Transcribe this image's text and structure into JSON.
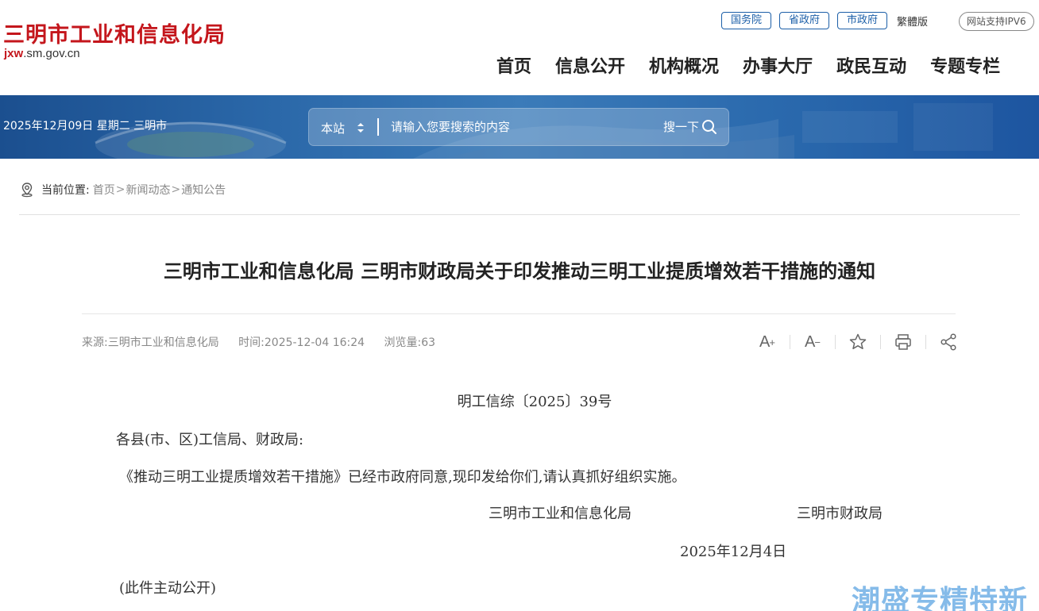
{
  "header": {
    "site_title": "三明市工业和信息化局",
    "domain_prefix": "jxw",
    "domain_suffix": ".sm.gov.cn",
    "top_links": [
      "国务院",
      "省政府",
      "市政府"
    ],
    "traditional_label": "繁體版",
    "ipv6_label": "网站支持IPV6",
    "nav": [
      "首页",
      "信息公开",
      "机构概况",
      "办事大厅",
      "政民互动",
      "专题专栏"
    ]
  },
  "banner": {
    "date_text": "2025年12月09日 星期二 三明市",
    "search_scope": "本站",
    "search_placeholder": "请输入您要搜索的内容",
    "search_button": "搜一下"
  },
  "breadcrumb": {
    "label": "当前位置:",
    "items": [
      "首页",
      "新闻动态",
      "通知公告"
    ]
  },
  "article": {
    "title": "三明市工业和信息化局 三明市财政局关于印发推动三明工业提质增效若干措施的通知",
    "source": "来源:三明市工业和信息化局",
    "time": "时间:2025-12-04 16:24",
    "views": "浏览量:63",
    "doc_number": "明工信综〔2025〕39号",
    "salutation": "各县(市、区)工信局、财政局:",
    "body": "《推动三明工业提质增效若干措施》已经市政府同意,现印发给你们,请认真抓好组织实施。",
    "signer1": "三明市工业和信息化局",
    "signer2": "三明市财政局",
    "date": "2025年12月4日",
    "note": "(此件主动公开)"
  },
  "tools": [
    "font-increase-icon",
    "font-decrease-icon",
    "star-icon",
    "print-icon",
    "share-icon"
  ],
  "watermark": "潮盛专精特新",
  "colors": {
    "brand_red": "#c4161c",
    "link_blue": "#1c5fa8",
    "banner_blue": "#2a67a8"
  }
}
